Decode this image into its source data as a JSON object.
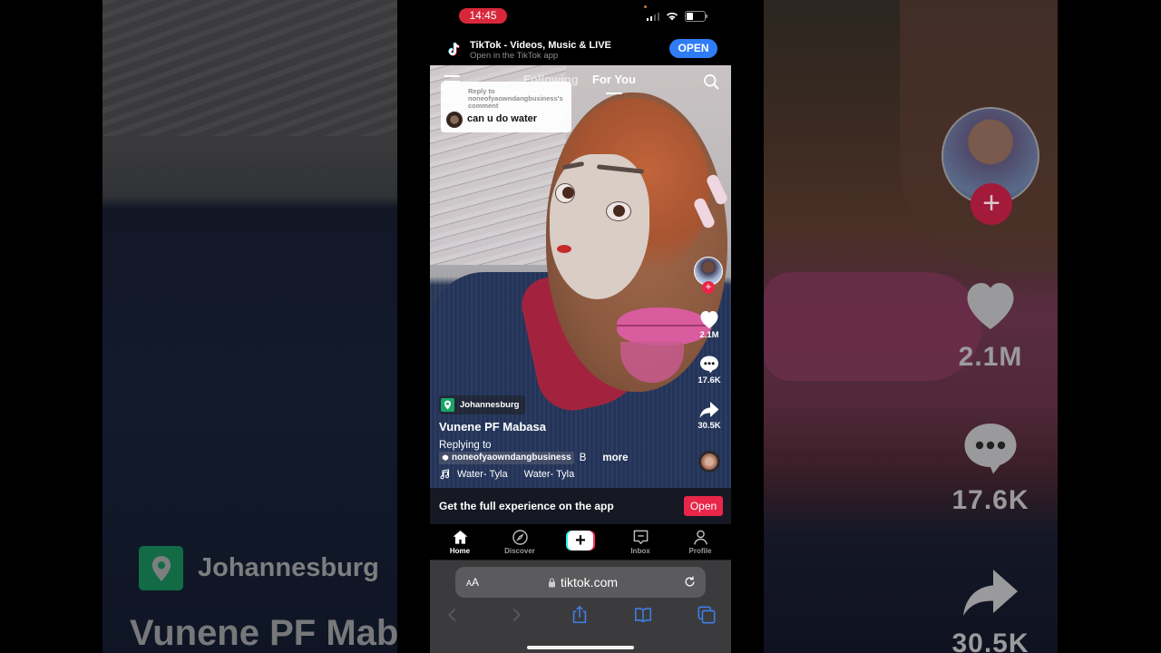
{
  "status_bar": {
    "time": "14:45"
  },
  "app_banner": {
    "title": "TikTok - Videos, Music & LIVE",
    "subtitle": "Open in the TikTok app",
    "open_label": "OPEN"
  },
  "top_nav": {
    "tabs": [
      {
        "label": "Following",
        "active": false
      },
      {
        "label": "For You",
        "active": true
      }
    ]
  },
  "reply_card": {
    "header": "Reply to noneofyaowndangbusiness's comment",
    "comment": "can u do water"
  },
  "actions": {
    "likes": "2.1M",
    "comments": "17.6K",
    "shares": "30.5K"
  },
  "video_meta": {
    "location": "Johannesburg",
    "author": "Vunene PF Mabasa",
    "caption_prefix": "Replying to",
    "mention": "noneofyaowndangbusiness",
    "caption_suffix": "B",
    "more_label": "more",
    "music": [
      "Water- Tyla",
      "Water- Tyla"
    ]
  },
  "get_app": {
    "text": "Get the full experience on the app",
    "open_label": "Open"
  },
  "bottom_nav": {
    "items": [
      {
        "label": "Home",
        "icon": "home-icon",
        "active": true
      },
      {
        "label": "Discover",
        "icon": "compass-icon",
        "active": false
      },
      {
        "label": "",
        "icon": "create-icon",
        "active": false
      },
      {
        "label": "Inbox",
        "icon": "inbox-icon",
        "active": false
      },
      {
        "label": "Profile",
        "icon": "profile-icon",
        "active": false
      }
    ]
  },
  "browser": {
    "text_size_label": "AA",
    "url": "tiktok.com"
  },
  "side_background": {
    "location": "Johannesburg",
    "author": "Vunene PF Mab",
    "likes": "2.1M",
    "comments": "17.6K",
    "shares": "30.5K"
  },
  "colors": {
    "tiktok_red": "#e8264a",
    "tiktok_cyan": "#25f4ee",
    "safari_blue": "#2f7cf6",
    "location_green": "#19a567",
    "recording_pill": "#d8273a"
  }
}
